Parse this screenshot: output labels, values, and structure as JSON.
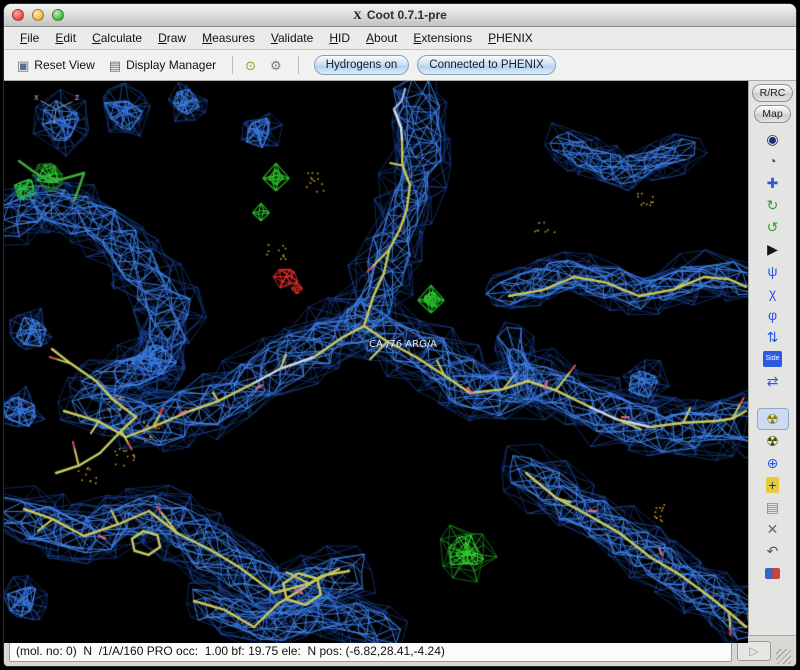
{
  "window": {
    "title": "Coot 0.7.1-pre",
    "icon_glyph": "X"
  },
  "menubar": {
    "items": [
      {
        "label": "File"
      },
      {
        "label": "Edit"
      },
      {
        "label": "Calculate"
      },
      {
        "label": "Draw"
      },
      {
        "label": "Measures"
      },
      {
        "label": "Validate"
      },
      {
        "label": "HID"
      },
      {
        "label": "About"
      },
      {
        "label": "Extensions"
      },
      {
        "label": "PHENIX"
      }
    ]
  },
  "toolbar": {
    "reset_view_label": "Reset View",
    "display_manager_label": "Display Manager",
    "hydrogens_label": "Hydrogens on",
    "phenix_label": "Connected to PHENIX",
    "icons": {
      "reset_view": "▣",
      "display_manager": "▤",
      "go_to_atom": "⊙",
      "preferences": "⚙"
    }
  },
  "right_panel": {
    "rrc_label": "R/RC",
    "map_label": "Map"
  },
  "sidebar": {
    "icons": [
      {
        "name": "real-space-refine-icon",
        "glyph": "◉",
        "color": "#1d2f6e"
      },
      {
        "name": "regularize-zone-icon",
        "glyph": "◔",
        "color": "#555555"
      },
      {
        "name": "fix-atoms-icon",
        "glyph": "✚",
        "color": "#2a5adf"
      },
      {
        "name": "rigid-body-fit-icon",
        "glyph": "↻",
        "color": "#2f9e2f"
      },
      {
        "name": "rotate-translate-icon",
        "glyph": "↺",
        "color": "#2f9e2f"
      },
      {
        "name": "auto-fit-rotamer-icon",
        "glyph": "▶",
        "color": "#141414"
      },
      {
        "name": "rotamers-icon",
        "glyph": "ψ",
        "color": "#2a5adf"
      },
      {
        "name": "edit-chi-angles-icon",
        "glyph": "χ",
        "color": "#2a5adf"
      },
      {
        "name": "torsion-general-icon",
        "glyph": "φ",
        "color": "#2a5adf"
      },
      {
        "name": "flip-peptide-icon",
        "glyph": "⇅",
        "color": "#2a5adf"
      },
      {
        "name": "side-chain-180-icon",
        "glyph": "Side",
        "color": "#ffffff",
        "bg": "#2a5adf"
      },
      {
        "name": "mutate-residue-icon",
        "glyph": "⇄",
        "color": "#2a5adf"
      },
      {
        "name": "add-terminal-residue-icon",
        "glyph": "☢",
        "color": "#8a7a00",
        "pressed": true
      },
      {
        "name": "add-alt-conf-icon",
        "glyph": "☢",
        "color": "#444400"
      },
      {
        "name": "simple-mutate-icon",
        "glyph": "⊕",
        "color": "#2a5adf"
      },
      {
        "name": "place-atom-icon",
        "glyph": "+",
        "color": "#333333",
        "bg": "#e8c940"
      },
      {
        "name": "clear-pending-icon",
        "glyph": "▤",
        "color": "#888888"
      },
      {
        "name": "delete-item-icon",
        "glyph": "✕",
        "color": "#666666"
      },
      {
        "name": "undo-icon",
        "glyph": "↶",
        "color": "#555555"
      },
      {
        "name": "run-refmac-icon",
        "glyph": "",
        "color": "#cc4433"
      }
    ]
  },
  "viewport": {
    "atom_label": "CA /76 ARG/A",
    "axis_x_label": "x",
    "axis_z_label": "z",
    "mesh_color": "#3a7ee8",
    "positive_density_color": "#2dcd2d",
    "negative_density_color": "#e12d2d",
    "model_carbon_color": "#c9c95f"
  },
  "statusbar": {
    "text": "(mol. no: 0)  N  /1/A/160 PRO occ:  1.00 bf: 19.75 ele:  N pos: (-6.82,28.41,-4.24)",
    "play_glyph": "▷"
  }
}
